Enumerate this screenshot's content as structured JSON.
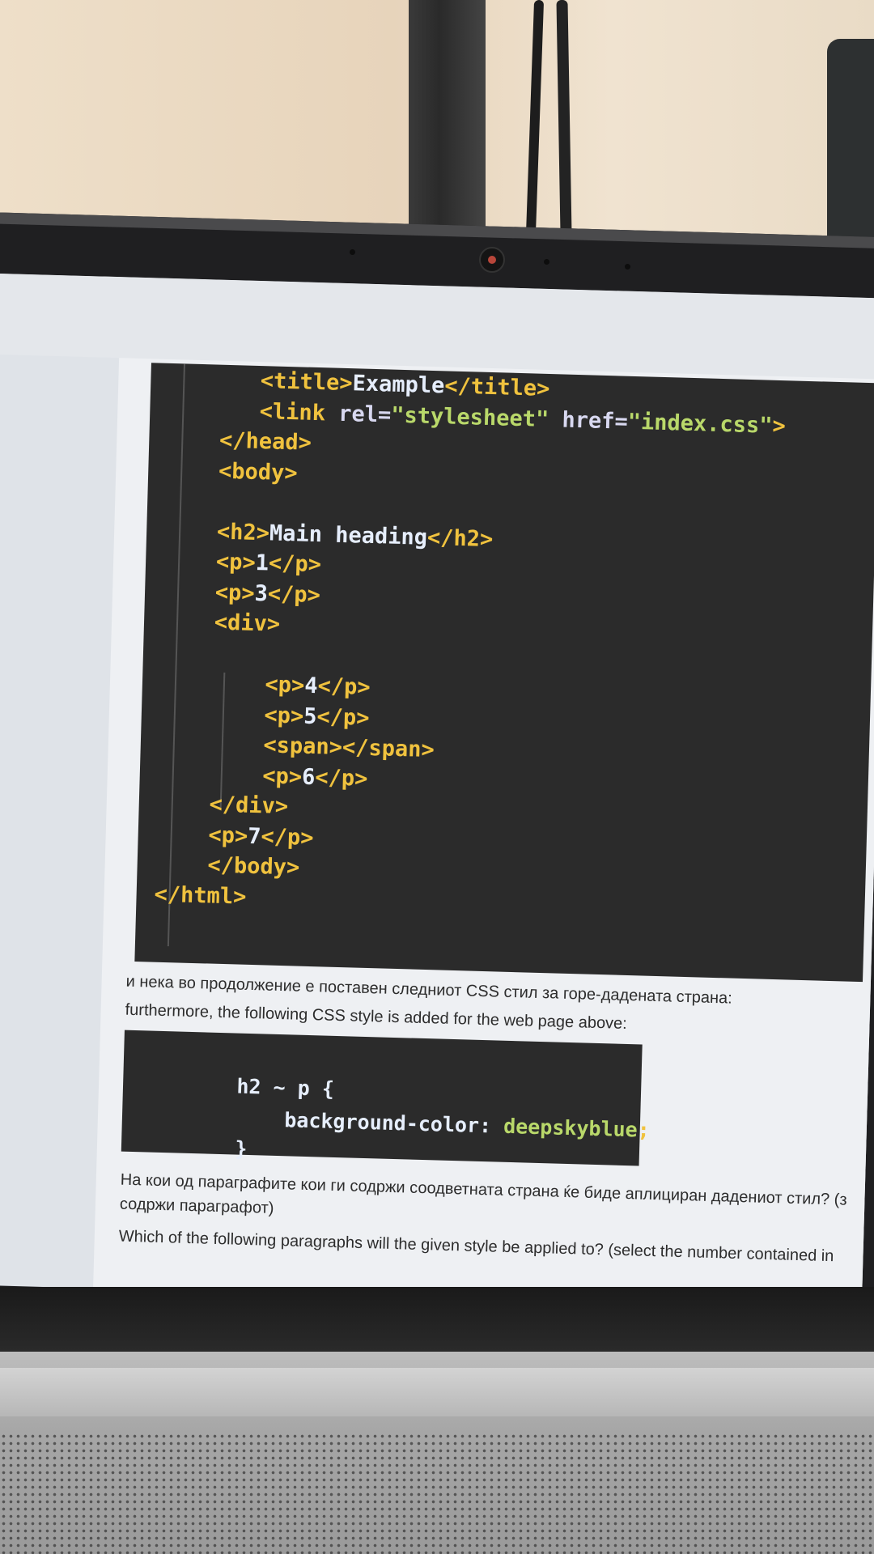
{
  "html_code": {
    "lines": [
      {
        "indent": 7,
        "parts": [
          [
            "tag",
            "<title>"
          ],
          [
            "txt",
            "Example"
          ],
          [
            "tag",
            "</title>"
          ]
        ]
      },
      {
        "indent": 7,
        "parts": [
          [
            "tag",
            "<link "
          ],
          [
            "attr",
            "rel="
          ],
          [
            "str",
            "\"stylesheet\""
          ],
          [
            "attr",
            " href="
          ],
          [
            "str",
            "\"index.css\""
          ],
          [
            "tag",
            ">"
          ]
        ]
      },
      {
        "indent": 4,
        "parts": [
          [
            "tag",
            "</head>"
          ]
        ]
      },
      {
        "indent": 4,
        "parts": [
          [
            "tag",
            "<body>"
          ]
        ]
      },
      {
        "indent": 0,
        "parts": []
      },
      {
        "indent": 4,
        "parts": [
          [
            "tag",
            "<h2>"
          ],
          [
            "txt",
            "Main heading"
          ],
          [
            "tag",
            "</h2>"
          ]
        ]
      },
      {
        "indent": 4,
        "parts": [
          [
            "tag",
            "<p>"
          ],
          [
            "txt",
            "1"
          ],
          [
            "tag",
            "</p>"
          ]
        ]
      },
      {
        "indent": 4,
        "parts": [
          [
            "tag",
            "<p>"
          ],
          [
            "txt",
            "3"
          ],
          [
            "tag",
            "</p>"
          ]
        ]
      },
      {
        "indent": 4,
        "parts": [
          [
            "tag",
            "<div>"
          ]
        ]
      },
      {
        "indent": 0,
        "parts": []
      },
      {
        "indent": 8,
        "parts": [
          [
            "tag",
            "<p>"
          ],
          [
            "txt",
            "4"
          ],
          [
            "tag",
            "</p>"
          ]
        ]
      },
      {
        "indent": 8,
        "parts": [
          [
            "tag",
            "<p>"
          ],
          [
            "txt",
            "5"
          ],
          [
            "tag",
            "</p>"
          ]
        ]
      },
      {
        "indent": 8,
        "parts": [
          [
            "tag",
            "<span></span>"
          ]
        ]
      },
      {
        "indent": 8,
        "parts": [
          [
            "tag",
            "<p>"
          ],
          [
            "txt",
            "6"
          ],
          [
            "tag",
            "</p>"
          ]
        ]
      },
      {
        "indent": 4,
        "parts": [
          [
            "tag",
            "</div>"
          ]
        ]
      },
      {
        "indent": 4,
        "parts": [
          [
            "tag",
            "<p>"
          ],
          [
            "txt",
            "7"
          ],
          [
            "tag",
            "</p>"
          ]
        ]
      },
      {
        "indent": 4,
        "parts": [
          [
            "tag",
            "</body>"
          ]
        ]
      },
      {
        "indent": 0,
        "parts": [
          [
            "tag",
            "</html>"
          ]
        ]
      }
    ]
  },
  "text": {
    "mk_intro": "и нека во продолжение е поставен следниот CSS стил за горе-дадената страна:",
    "en_intro": "furthermore, the following CSS style is added for the web page above:",
    "mk_question_1": "На кои од параграфите кои ги содржи соодветната страна ќе биде аплициран дадениот стил? (з",
    "mk_question_2": "содржи параграфот)",
    "en_question": "Which of the following paragraphs will the given style be applied to? (select the number contained in"
  },
  "css_code": {
    "selector": "h2 ~ p {",
    "property": "background-color:",
    "value": "deepskyblue",
    "semicolon": ";",
    "close": "}"
  }
}
